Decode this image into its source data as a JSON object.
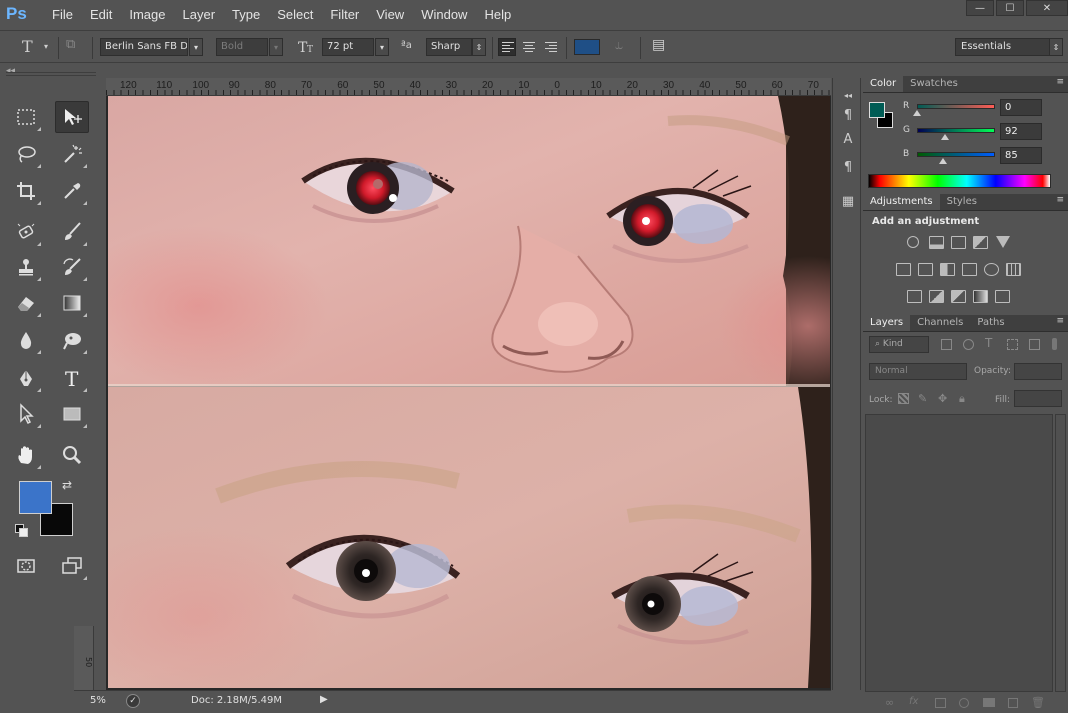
{
  "app": {
    "logo": "Ps"
  },
  "menu": [
    "File",
    "Edit",
    "Image",
    "Layer",
    "Type",
    "Select",
    "Filter",
    "View",
    "Window",
    "Help"
  ],
  "window_controls": {
    "minimize": "—",
    "maximize": "☐",
    "close": "✕"
  },
  "options": {
    "tool_glyph": "T",
    "font_family": "Berlin Sans FB D...",
    "font_style": "Bold",
    "font_size": "72 pt",
    "antialias_label": "ªa",
    "antialias": "Sharp",
    "workspace": "Essentials",
    "text_color": "#1f4f86"
  },
  "ruler": {
    "labels": [
      "120",
      "110",
      "100",
      "90",
      "80",
      "70",
      "60",
      "50",
      "40",
      "30",
      "20",
      "10",
      "0",
      "10",
      "20",
      "30",
      "40",
      "50",
      "60",
      "70"
    ],
    "left_label": "50"
  },
  "tools": {
    "foreground_color": "#3b74c9",
    "background_color": "#080808"
  },
  "color_panel": {
    "tabs": [
      "Color",
      "Swatches"
    ],
    "channels": [
      {
        "label": "R",
        "value": "0",
        "fraction": 0.0
      },
      {
        "label": "G",
        "value": "92",
        "fraction": 0.36
      },
      {
        "label": "B",
        "value": "85",
        "fraction": 0.33
      }
    ],
    "fg_swatch": "#005c55",
    "bg_swatch": "#000000"
  },
  "adjustments_panel": {
    "tabs": [
      "Adjustments",
      "Styles"
    ],
    "heading": "Add an adjustment"
  },
  "layers_panel": {
    "tabs": [
      "Layers",
      "Channels",
      "Paths"
    ],
    "kind_filter": "Kind",
    "blend_mode": "Normal",
    "opacity_label": "Opacity:",
    "lock_label": "Lock:",
    "fill_label": "Fill:"
  },
  "status": {
    "zoom": "5%",
    "doc_info": "Doc: 2.18M/5.49M"
  },
  "collapse_glyph": "◂◂"
}
